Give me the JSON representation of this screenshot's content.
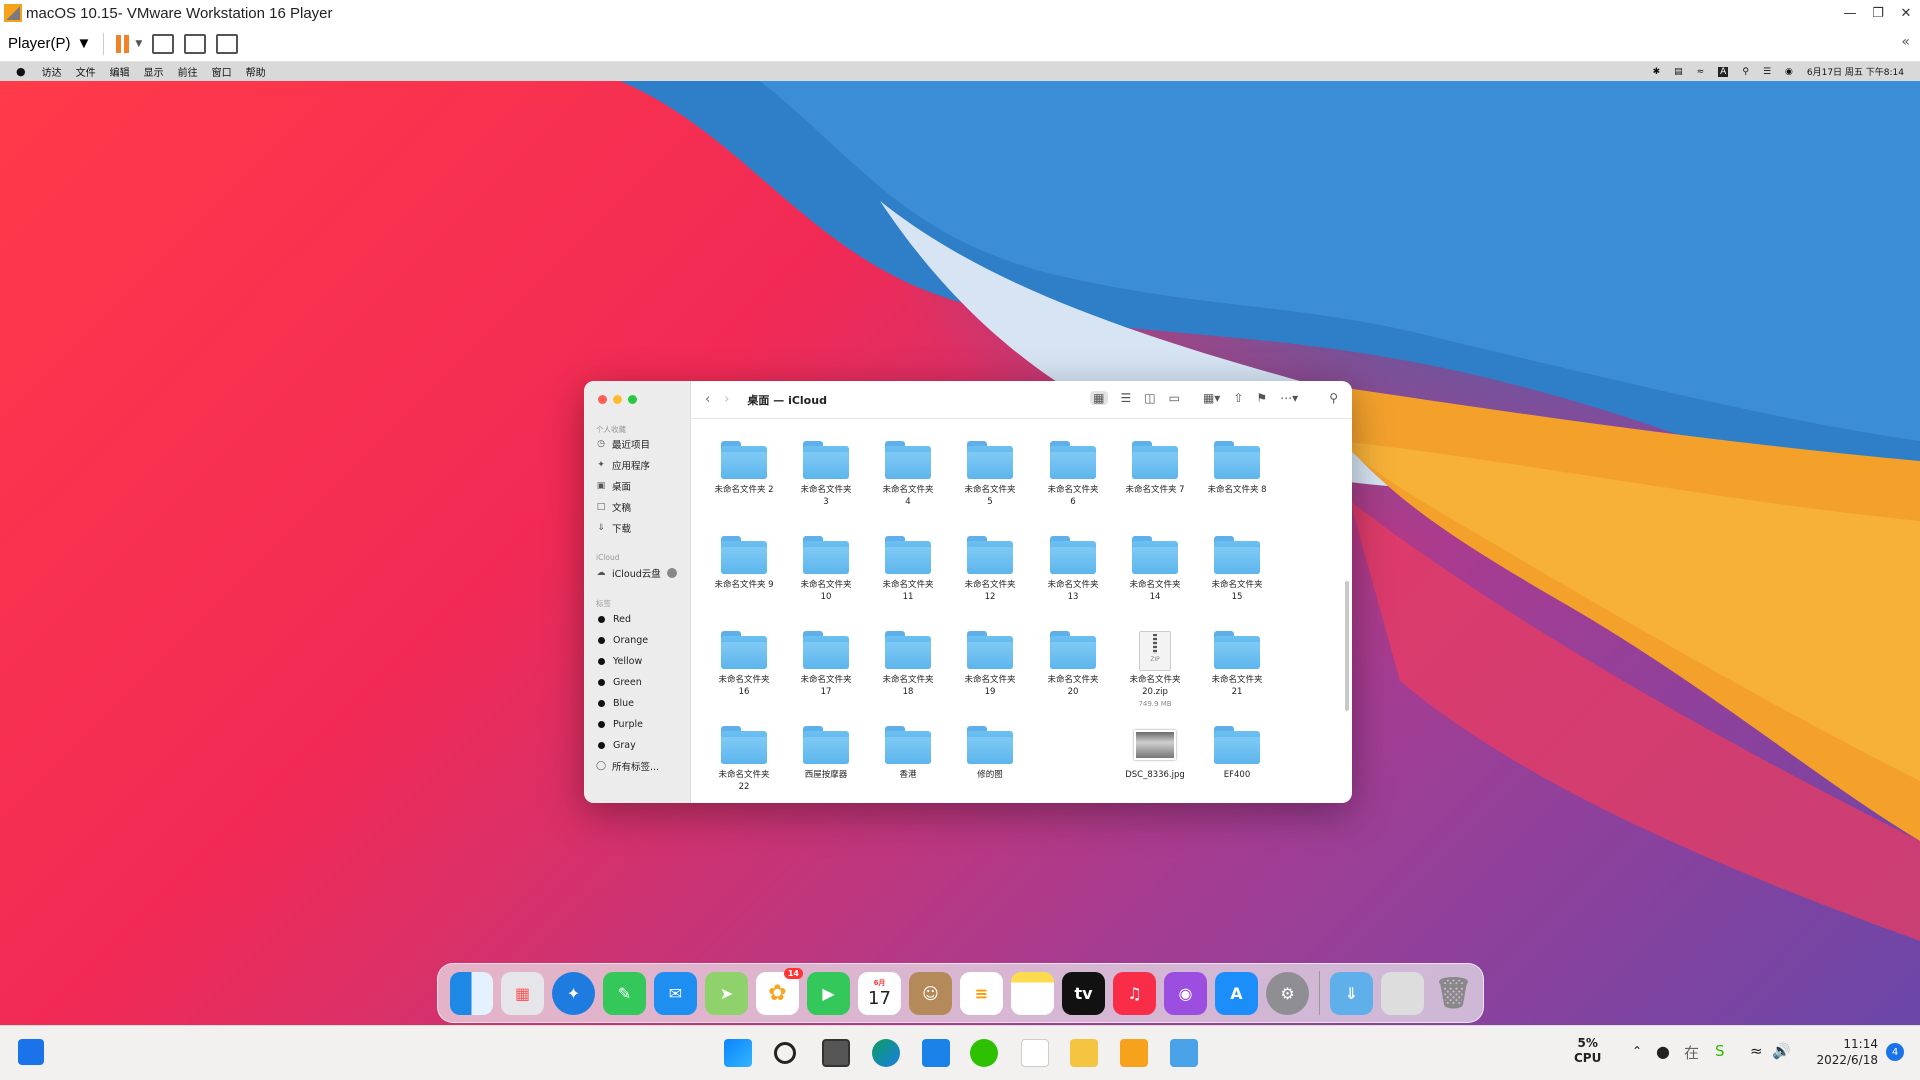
{
  "vm": {
    "title": "macOS 10.15- VMware Workstation 16 Player",
    "player_menu": "Player(P)"
  },
  "mac_menubar": {
    "items": [
      "访达",
      "文件",
      "编辑",
      "显示",
      "前往",
      "窗口",
      "帮助"
    ],
    "clock": "6月17日 周五 下午8:14",
    "input_method": "A"
  },
  "finder": {
    "title": "桌面 — iCloud",
    "sidebar": {
      "favorites_label": "个人收藏",
      "favorites": [
        "最近项目",
        "应用程序",
        "桌面",
        "文稿",
        "下载"
      ],
      "icloud_label": "iCloud",
      "icloud_item": "iCloud云盘",
      "tags_label": "标签",
      "tags": [
        "Red",
        "Orange",
        "Yellow",
        "Green",
        "Blue",
        "Purple",
        "Gray"
      ],
      "all_tags": "所有标签..."
    },
    "items": [
      {
        "line1": "未命名文件夹 2",
        "line2": ""
      },
      {
        "line1": "未命名文件夹",
        "line2": "3"
      },
      {
        "line1": "未命名文件夹",
        "line2": "4"
      },
      {
        "line1": "未命名文件夹",
        "line2": "5"
      },
      {
        "line1": "未命名文件夹",
        "line2": "6"
      },
      {
        "line1": "未命名文件夹 7",
        "line2": ""
      },
      {
        "line1": "未命名文件夹 8",
        "line2": ""
      },
      {
        "line1": "未命名文件夹 9",
        "line2": ""
      },
      {
        "line1": "未命名文件夹",
        "line2": "10"
      },
      {
        "line1": "未命名文件夹",
        "line2": "11"
      },
      {
        "line1": "未命名文件夹",
        "line2": "12"
      },
      {
        "line1": "未命名文件夹",
        "line2": "13"
      },
      {
        "line1": "未命名文件夹",
        "line2": "14"
      },
      {
        "line1": "未命名文件夹",
        "line2": "15"
      },
      {
        "line1": "未命名文件夹",
        "line2": "16"
      },
      {
        "line1": "未命名文件夹",
        "line2": "17"
      },
      {
        "line1": "未命名文件夹",
        "line2": "18"
      },
      {
        "line1": "未命名文件夹",
        "line2": "19"
      },
      {
        "line1": "未命名文件夹",
        "line2": "20"
      },
      {
        "line1": "未命名文件夹",
        "line2": "20.zip",
        "size": "749.9 MB",
        "kind": "zip"
      },
      {
        "line1": "未命名文件夹",
        "line2": "21"
      },
      {
        "line1": "未命名文件夹",
        "line2": "22"
      },
      {
        "line1": "西屋按摩器",
        "line2": ""
      },
      {
        "line1": "香港",
        "line2": ""
      },
      {
        "line1": "修的图",
        "line2": ""
      },
      {
        "line1": "DSC_8336.jpg",
        "line2": "",
        "kind": "photo"
      },
      {
        "line1": "EF400",
        "line2": ""
      }
    ]
  },
  "dock": {
    "calendar_month": "6月",
    "calendar_day": "17",
    "photos_badge": "14",
    "tv_label": "tv"
  },
  "taskbar": {
    "cpu_percent": "5%",
    "cpu_label": "CPU",
    "time": "11:14",
    "date": "2022/6/18",
    "notifications": "4"
  }
}
